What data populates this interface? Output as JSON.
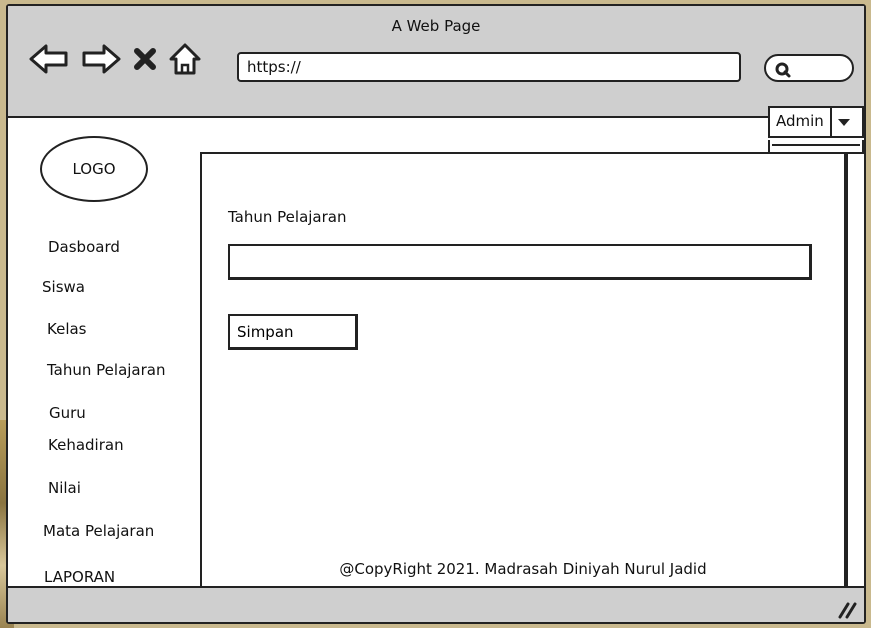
{
  "browser": {
    "title": "A Web Page",
    "url": "https://",
    "icons": [
      "back-icon",
      "forward-icon",
      "close-icon",
      "home-icon",
      "search-icon"
    ]
  },
  "logo": {
    "label": "LOGO"
  },
  "user_menu": {
    "label": "Admin"
  },
  "sidebar": {
    "items": [
      {
        "label": "Dasboard"
      },
      {
        "label": "Siswa"
      },
      {
        "label": "Kelas"
      },
      {
        "label": "Tahun Pelajaran"
      },
      {
        "label": "Guru"
      },
      {
        "label": "Kehadiran"
      },
      {
        "label": "Nilai"
      },
      {
        "label": "Mata Pelajaran"
      },
      {
        "label": "LAPORAN"
      }
    ]
  },
  "form": {
    "label": "Tahun Pelajaran",
    "value": "",
    "submit_label": "Simpan"
  },
  "footer": {
    "copyright": "@CopyRight 2021. Madrasah Diniyah Nurul Jadid"
  }
}
